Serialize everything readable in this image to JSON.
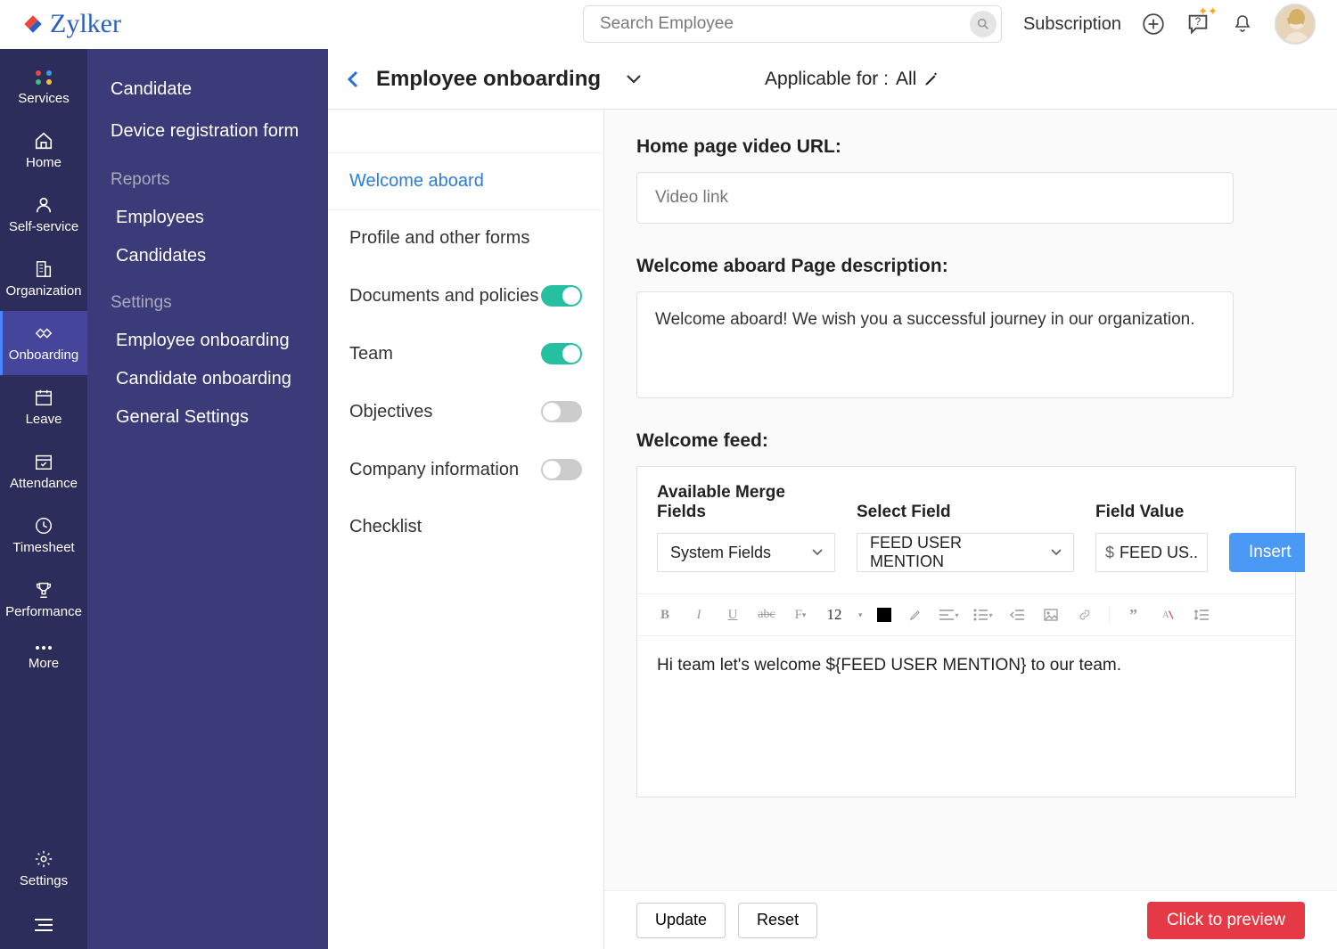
{
  "brand": {
    "name": "Zylker"
  },
  "search": {
    "placeholder": "Search Employee"
  },
  "top_links": {
    "subscription": "Subscription"
  },
  "rail": {
    "items": [
      {
        "id": "services",
        "label": "Services"
      },
      {
        "id": "home",
        "label": "Home"
      },
      {
        "id": "selfservice",
        "label": "Self-service"
      },
      {
        "id": "organization",
        "label": "Organization"
      },
      {
        "id": "onboarding",
        "label": "Onboarding"
      },
      {
        "id": "leave",
        "label": "Leave"
      },
      {
        "id": "attendance",
        "label": "Attendance"
      },
      {
        "id": "timesheet",
        "label": "Timesheet"
      },
      {
        "id": "performance",
        "label": "Performance"
      },
      {
        "id": "more",
        "label": "More"
      }
    ],
    "bottom": {
      "id": "settings",
      "label": "Settings"
    }
  },
  "sidepanel": {
    "links": {
      "candidate": "Candidate",
      "device_registration": "Device registration form"
    },
    "reports": {
      "heading": "Reports",
      "employees": "Employees",
      "candidates": "Candidates"
    },
    "settings": {
      "heading": "Settings",
      "employee_onboarding": "Employee onboarding",
      "candidate_onboarding": "Candidate onboarding",
      "general": "General Settings"
    }
  },
  "header": {
    "title": "Employee onboarding",
    "applicable_label": "Applicable for :",
    "applicable_value": "All"
  },
  "subtabs": {
    "welcome": {
      "label": "Welcome aboard"
    },
    "profile": {
      "label": "Profile and other forms"
    },
    "documents": {
      "label": "Documents and policies",
      "on": true
    },
    "team": {
      "label": "Team",
      "on": true
    },
    "objectives": {
      "label": "Objectives",
      "on": false
    },
    "company": {
      "label": "Company information",
      "on": false
    },
    "checklist": {
      "label": "Checklist"
    }
  },
  "form": {
    "video_url_label": "Home page video URL:",
    "video_url_placeholder": "Video link",
    "desc_label": "Welcome aboard Page description:",
    "desc_value": "Welcome aboard! We wish you a successful journey in our organization.",
    "feed_label": "Welcome feed:"
  },
  "merge": {
    "available_label": "Available Merge Fields",
    "available_value": "System Fields",
    "select_label": "Select Field",
    "select_value": "FEED USER MENTION",
    "value_label": "Field Value",
    "value_value": "FEED US..",
    "insert_label": "Insert"
  },
  "toolbar": {
    "font_size": "12"
  },
  "editor": {
    "body": "Hi team let's welcome ${FEED USER MENTION} to our team."
  },
  "footer": {
    "update": "Update",
    "reset": "Reset",
    "preview": "Click to preview"
  }
}
